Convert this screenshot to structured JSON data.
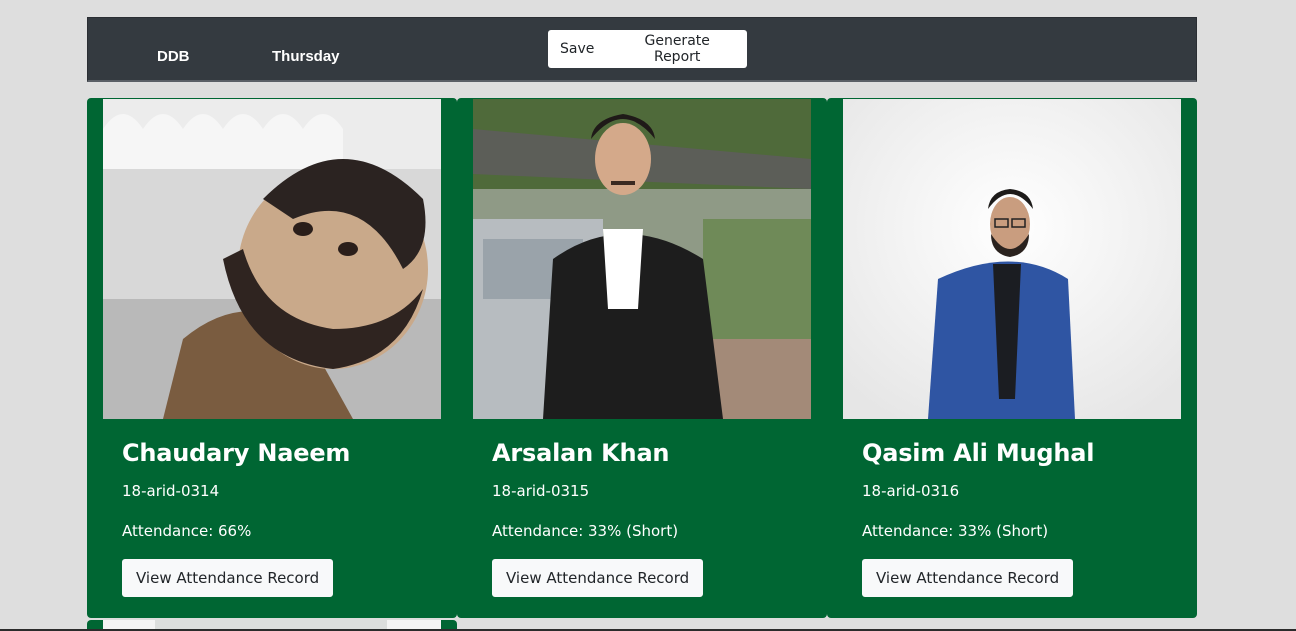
{
  "header": {
    "brand": "DDB",
    "day": "Thursday",
    "actions": [
      "Save",
      "Generate Report"
    ]
  },
  "students": [
    {
      "name": "Chaudary Naeem",
      "roll": "18-arid-0314",
      "attendance": "Attendance: 66%",
      "button": "View Attendance Record"
    },
    {
      "name": "Arsalan Khan",
      "roll": "18-arid-0315",
      "attendance": "Attendance: 33% (Short)",
      "button": "View Attendance Record"
    },
    {
      "name": "Qasim Ali Mughal",
      "roll": "18-arid-0316",
      "attendance": "Attendance: 33% (Short)",
      "button": "View Attendance Record"
    }
  ],
  "colors": {
    "navbar": "#343a40",
    "card": "#006633",
    "background": "#dedede"
  }
}
